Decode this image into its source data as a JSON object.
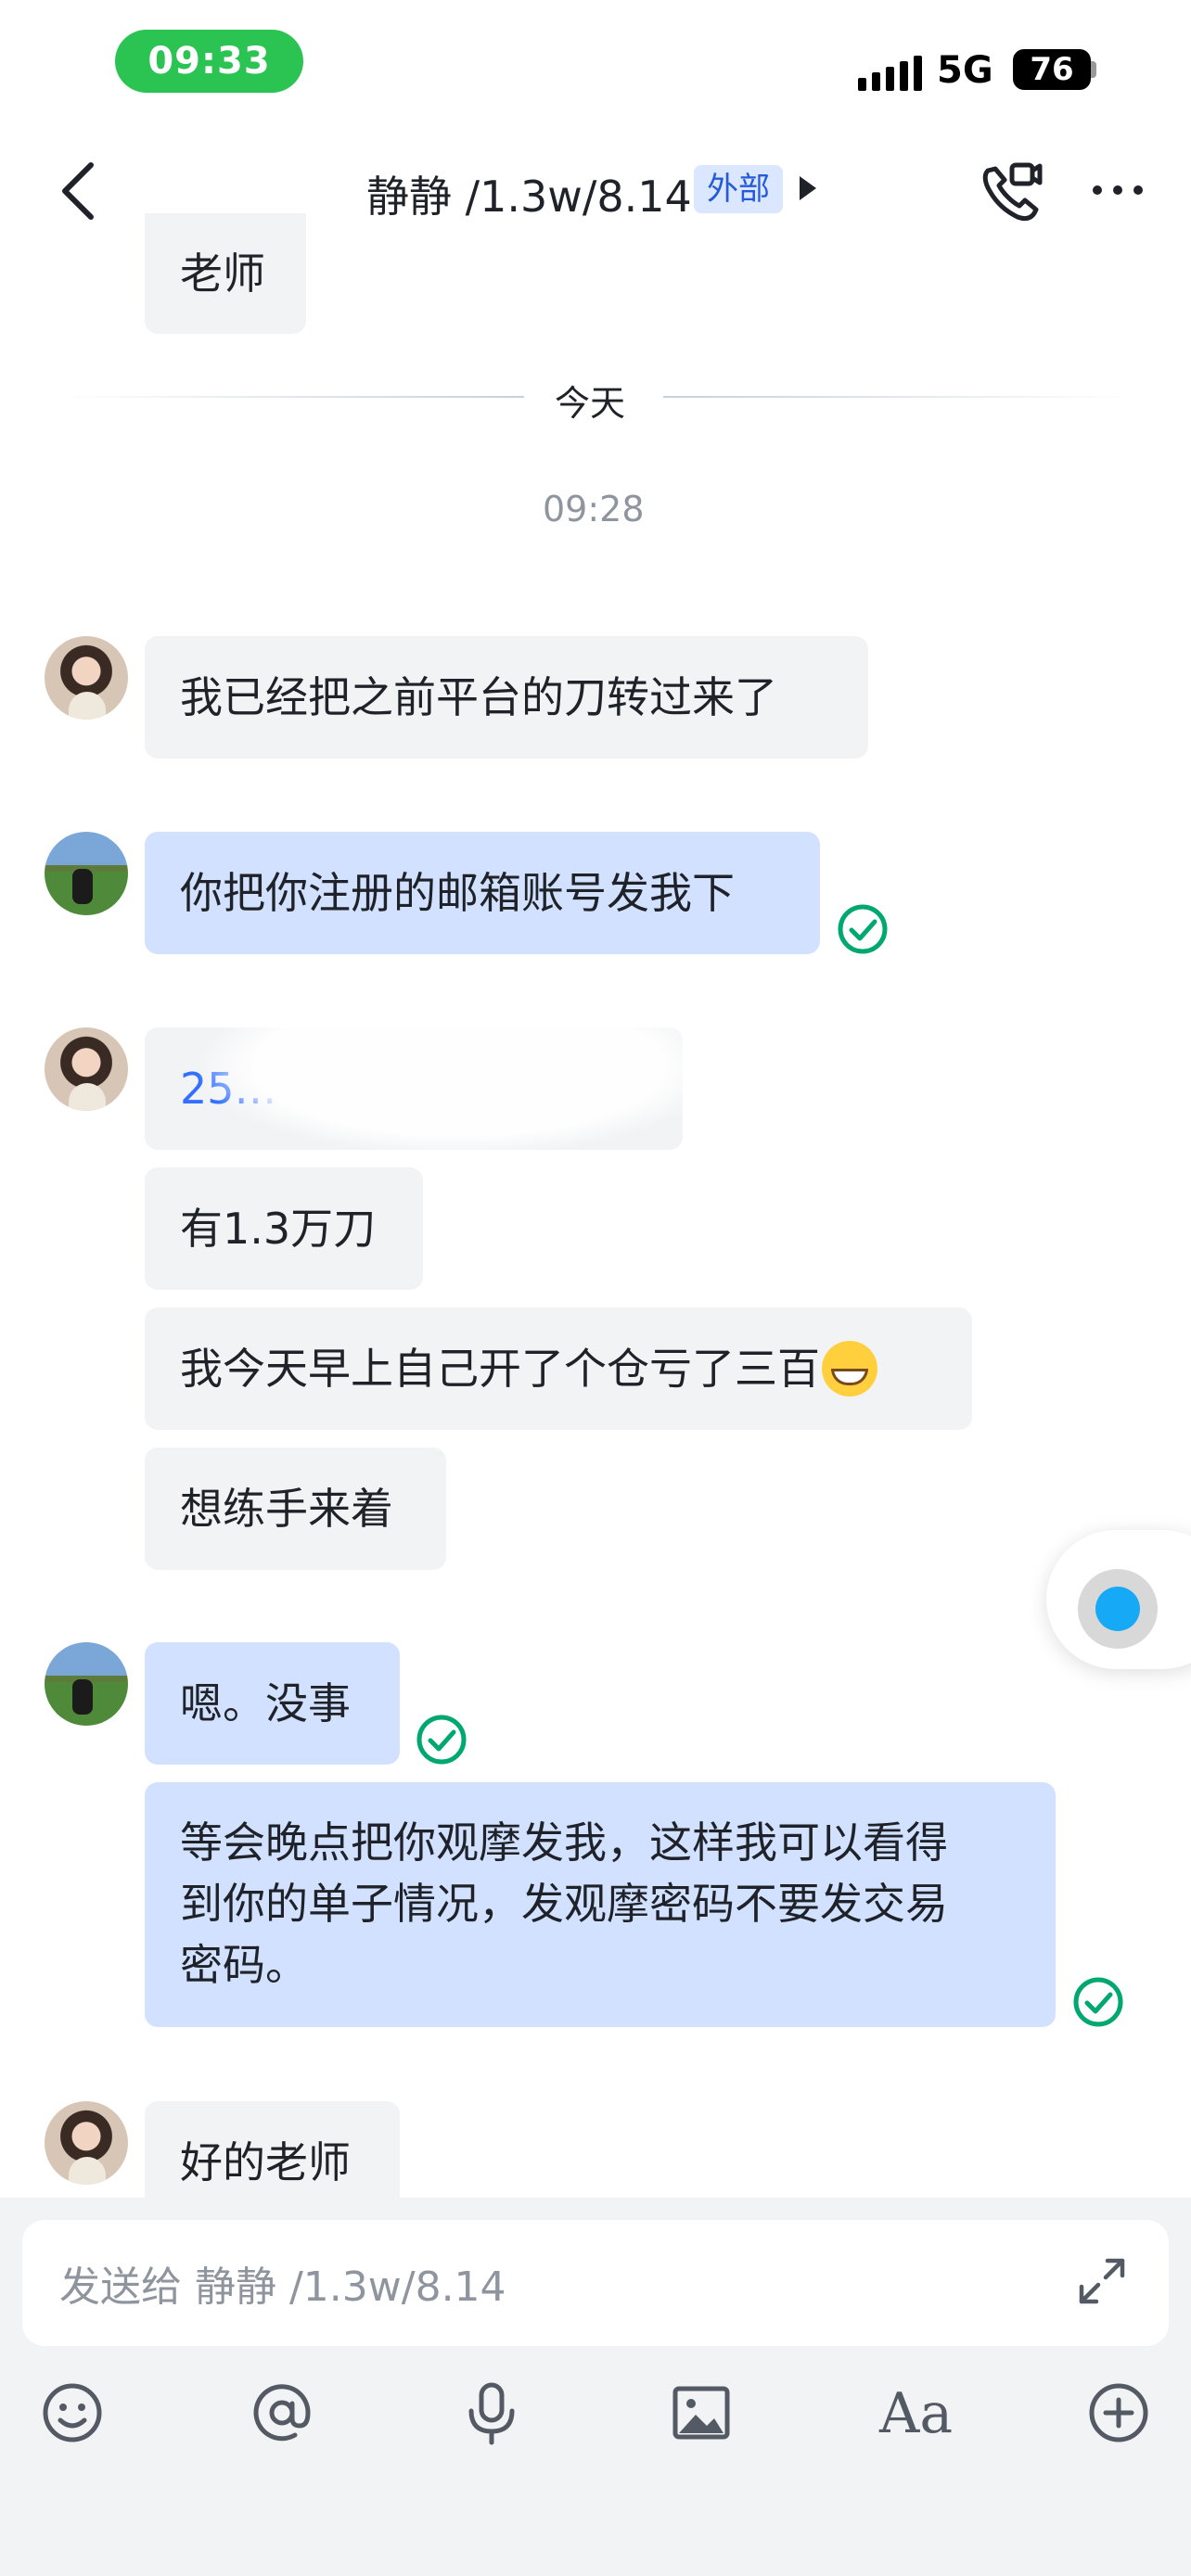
{
  "status_bar": {
    "time": "09:33",
    "network": "5G",
    "battery": "76"
  },
  "header": {
    "title": "静静 /1.3w/8.14",
    "tag": "外部"
  },
  "chat": {
    "partial_top": "老师",
    "day_divider": "今天",
    "timestamp": "09:28",
    "messages": [
      {
        "sender": "contact",
        "text": "我已经把之前平台的刀转过来了"
      },
      {
        "sender": "me",
        "text": "你把你注册的邮箱账号发我下",
        "read": true
      },
      {
        "sender": "contact",
        "text": "25…",
        "redacted": true
      },
      {
        "sender": "contact",
        "text": "有1.3万刀"
      },
      {
        "sender": "contact",
        "text": "我今天早上自己开了个仓亏了三百",
        "emoji": "grin-emoji"
      },
      {
        "sender": "contact",
        "text": "想练手来着"
      },
      {
        "sender": "me",
        "text": "嗯。没事",
        "read": true
      },
      {
        "sender": "me",
        "lines": [
          "等会晚点把你观摩发我，这样我可以看得",
          "到你的单子情况，发观摩密码不要发交易",
          "密码。"
        ],
        "read": true
      },
      {
        "sender": "contact",
        "text": "好的老师"
      }
    ]
  },
  "composer": {
    "placeholder": "发送给 静静 /1.3w/8.14",
    "toolbar": [
      "emoji-icon",
      "mention-icon",
      "voice-icon",
      "image-icon",
      "text-format-icon",
      "add-icon"
    ],
    "text_format_label": "Aa"
  },
  "colors": {
    "accent": "#3370ff",
    "outgoing_bubble": "#d1e1ff",
    "incoming_bubble": "#f2f3f5",
    "read_check": "#00a870",
    "status_green": "#2bc351"
  }
}
